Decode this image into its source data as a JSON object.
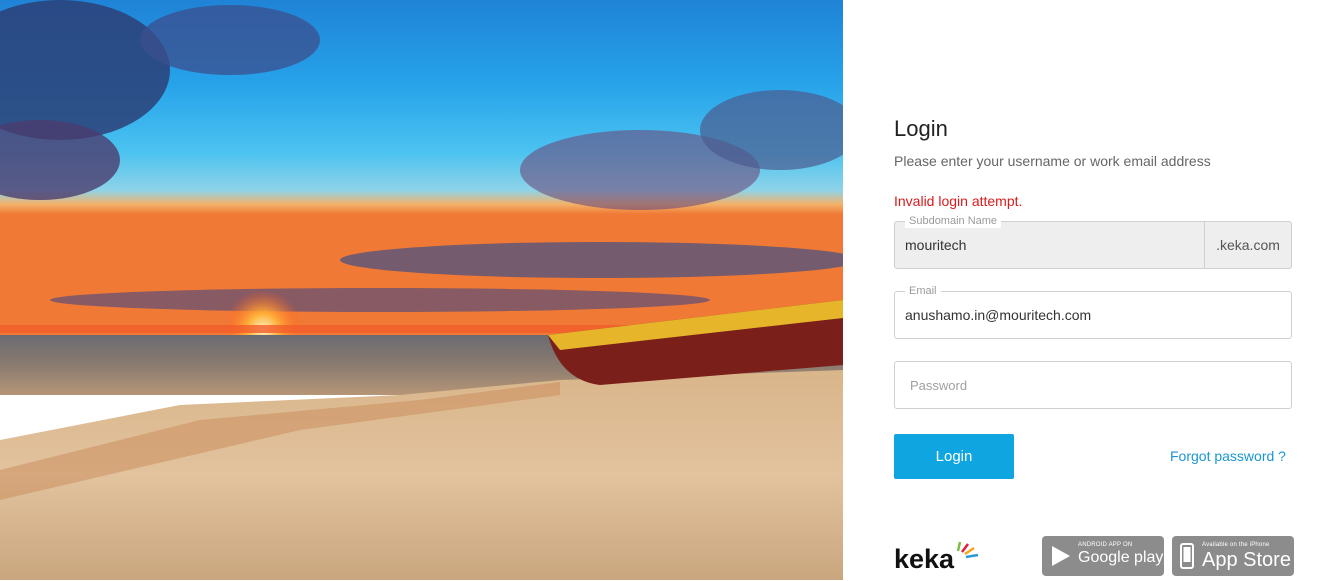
{
  "login": {
    "title": "Login",
    "subtitle": "Please enter your username or work email address",
    "error": "Invalid login attempt.",
    "subdomain": {
      "label": "Subdomain Name",
      "value": "mouritech",
      "suffix": ".keka.com"
    },
    "email": {
      "label": "Email",
      "value": "anushamo.in@mouritech.com"
    },
    "password": {
      "placeholder": "Password"
    },
    "submit_label": "Login",
    "forgot_label": "Forgot password ?"
  },
  "footer": {
    "brand": "keka",
    "google_play": {
      "small": "ANDROID APP ON",
      "big": "Google play"
    },
    "app_store": {
      "small": "Available on the iPhone",
      "big": "App Store"
    }
  },
  "colors": {
    "accent": "#0ea5e0",
    "error": "#d81b1b",
    "link": "#1a96d3",
    "store_badge": "#8c8c8c"
  },
  "icons": [
    "google-play-icon",
    "phone-icon",
    "keka-logo-icon"
  ]
}
